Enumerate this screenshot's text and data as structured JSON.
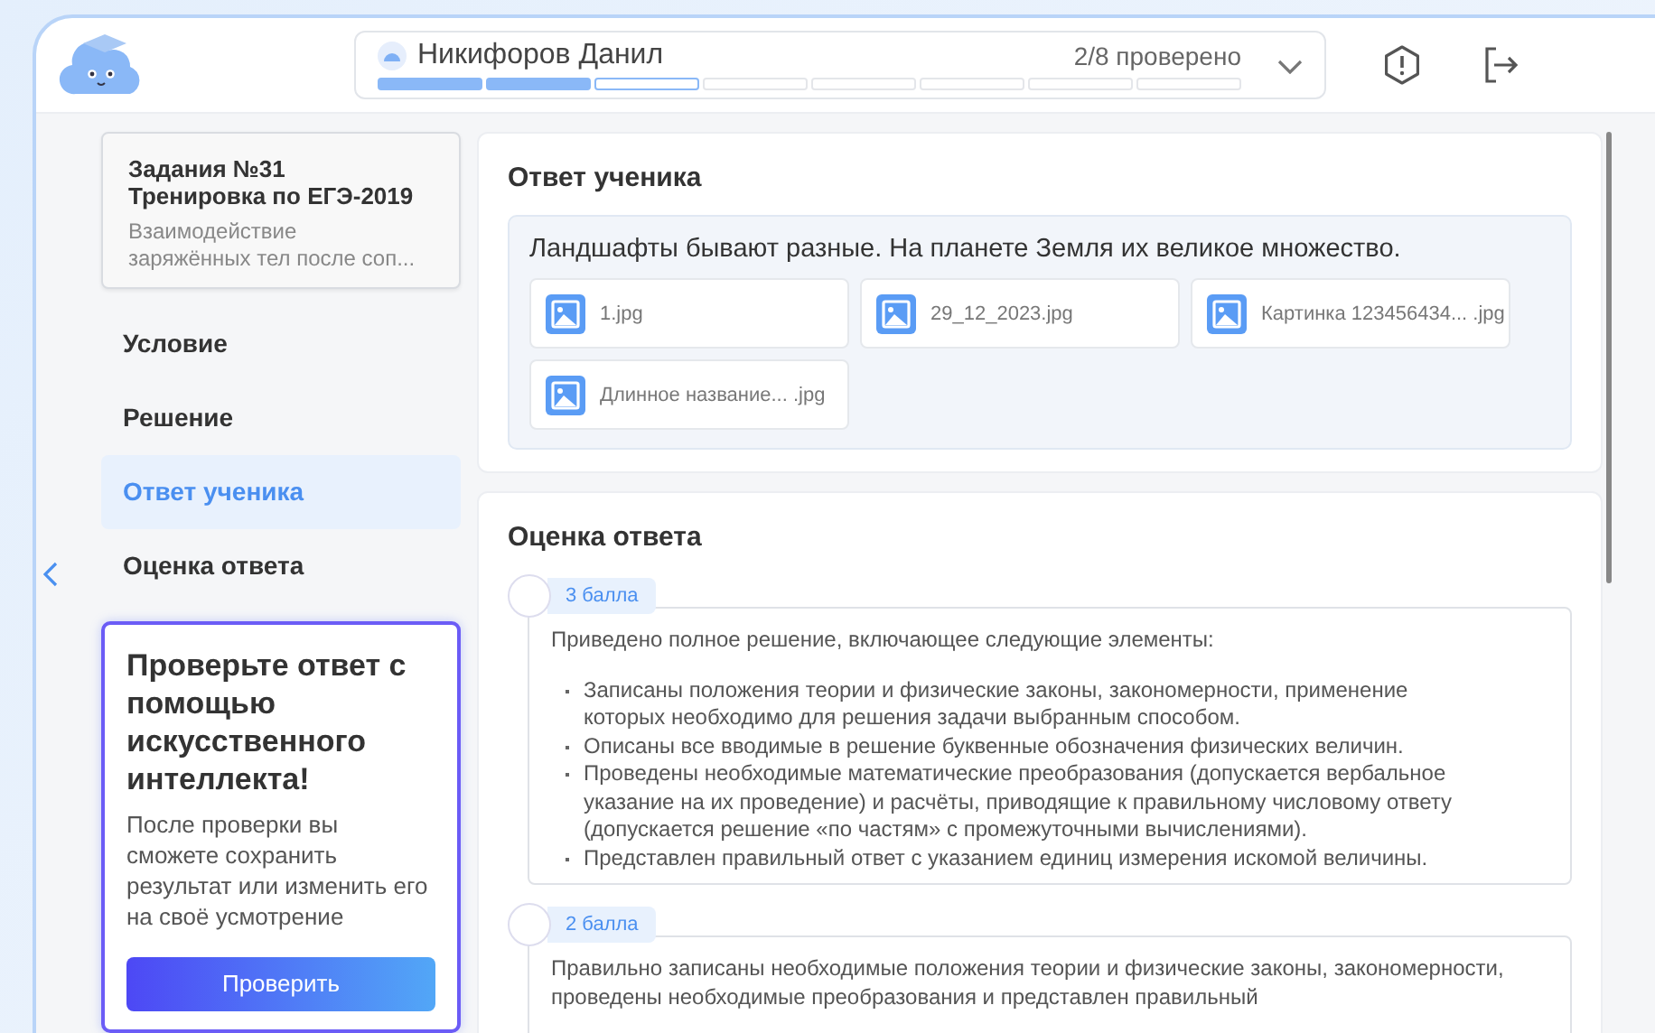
{
  "header": {
    "student": "Никифоров Данил",
    "progress_text": "2/8 проверено",
    "progress": [
      {
        "filled": true,
        "current": false
      },
      {
        "filled": true,
        "current": false
      },
      {
        "filled": false,
        "current": true
      },
      {
        "filled": false,
        "current": false
      },
      {
        "filled": false,
        "current": false
      },
      {
        "filled": false,
        "current": false
      },
      {
        "filled": false,
        "current": false
      },
      {
        "filled": false,
        "current": false
      }
    ]
  },
  "task": {
    "title": "Задания №31\nТренировка по ЕГЭ-2019",
    "subtitle": "Взаимодействие\nзаряжённых тел после соп..."
  },
  "nav": [
    {
      "label": "Условие",
      "selected": false
    },
    {
      "label": "Решение",
      "selected": false
    },
    {
      "label": "Ответ ученика",
      "selected": true
    },
    {
      "label": "Оценка ответа",
      "selected": false
    }
  ],
  "ai_card": {
    "title": "Проверьте ответ с помощью искусственного интеллекта!",
    "text": "После проверки вы сможете сохранить результат или изменить его на своё усмотрение",
    "button": "Проверить"
  },
  "answer": {
    "title": "Ответ ученика",
    "text": "Ландшафты бывают разные. На планете Земля их великое множество.",
    "files": [
      "1.jpg",
      "29_12_2023.jpg",
      "Картинка 123456434... .jpg",
      "Длинное название... .jpg"
    ]
  },
  "grading": {
    "title": "Оценка ответа",
    "options": [
      {
        "score": "3 балла",
        "selected": false,
        "intro": "Приведено полное решение, включающее следующие элементы:",
        "bullets": [
          "Записаны положения теории и физические законы, закономерности, применение которых необходимо для решения задачи выбранным способом.",
          "Описаны все вводимые в решение буквенные обозначения физических величин.",
          "Проведены необходимые математические преобразования (допускается вербальное указание на их проведение) и расчёты, приводящие к правильному числовому ответу (допускается решение «по частям» с промежуточными вычислениями).",
          "Представлен правильный ответ с указанием единиц измерения искомой величины."
        ]
      },
      {
        "score": "2 балла",
        "selected": false,
        "intro": "Правильно записаны необходимые положения теории и физические законы, закономерности, проведены необходимые преобразования и представлен правильный"
      }
    ]
  }
}
